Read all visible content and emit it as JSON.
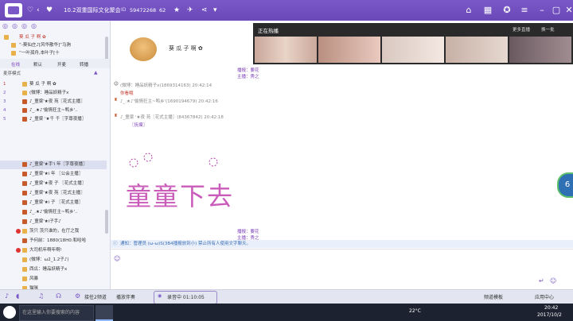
{
  "titlebar": {
    "room_title": "10.2双重国际文化聚会",
    "room_id": "59472268",
    "viewer_count": "62"
  },
  "left_panel": {
    "header_items": [
      {
        "label": "葵 瓜 子 啊 ✿",
        "color": "#c0392b"
      },
      {
        "label": "“-葵仙庄♪[风华散华]”马驹",
        "color": "#555"
      },
      {
        "label": "“一叶孤舟,本叶子[十",
        "color": "#555"
      }
    ],
    "tabs": [
      "在线",
      "默认",
      "开麦",
      "转播"
    ],
    "mic_section_label": "麦序模式",
    "mic_list": [
      "葵 瓜 子 啊 ✿",
      "(微博：睡品妖精子x",
      "♪_童梁'★夜 苑〖花式主播〗",
      "♪_.★♪'偷情狂主~鸭乡'..",
      "♪_童梁 '★千 千〖字尊夜播〗"
    ],
    "members": [
      "♪_童梁'★手'i 年〖字尊夜播〗",
      "♪_童梁'★i 年 〖公会主播〗",
      "♪_童梁'★夜 子 〖花式主播〗",
      "♪_童梁'★夜 苑〖花式主播〗",
      "♪_童梁'★i 子 〖花式主播〗",
      "♪_.★♪'偷情狂主~鸭乡'..",
      "♪_童梁'★i子手♪",
      "茨只  茨只谁的，在厅之我",
      "予何前：1880(18H0:和哈哈",
      "大司机年啊年啊!",
      "(微博：ω2_1.2子♪)",
      "西瓜：睡品妖精子x",
      "风暴",
      "猫咪"
    ]
  },
  "profile": {
    "name": "葵 瓜 子 啊 ✿"
  },
  "hot": {
    "label": "正在热播",
    "more": "更多直播",
    "refresh": "换一批"
  },
  "chat_messages": [
    {
      "name": "(微博：睡品妖精子x(1869314163) 20:42:14",
      "color": "#888"
    },
    {
      "name": "你看哦",
      "color": "#c0392b"
    },
    {
      "name": "♪_.★♪'偷情狂主~鸭乡'(1690194679) 20:42:16",
      "color": "#888"
    },
    {
      "name": "♪_童梁 '★夜 苑〖花式主播〗(84367842) 20:42:18",
      "color": "#888"
    },
    {
      "name": "〖抚摸〗",
      "color": "#7a3db8"
    }
  ],
  "chat_side_notes": [
    {
      "label": "播报：要花",
      "label2": "主播：秀之"
    },
    {
      "label": "播报：要花",
      "label2": "主播：秀之"
    }
  ],
  "big_text": "童童下去",
  "notice": "通知：管理员  (ω-ω)S(3B4播报放到小)  禁止所有人使用文字聊天。",
  "toolbar": {
    "items": [
      "接任2频道",
      "播放伴奏",
      "录音中 01:10:05"
    ],
    "right_items": [
      "频道模板",
      "应用中心"
    ]
  },
  "taskbar": {
    "search_placeholder": "在这里输入你要搜索的内容",
    "temperature": "22°C",
    "time": "20:42",
    "date": "2017/10/2"
  },
  "side_badge": "6"
}
